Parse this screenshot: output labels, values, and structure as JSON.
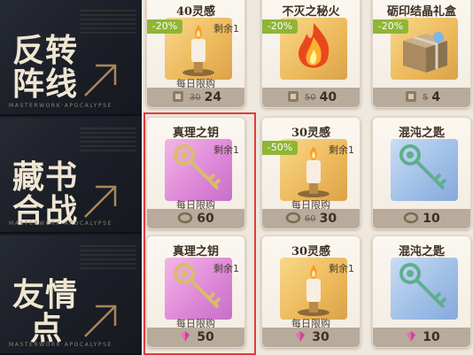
{
  "categories": [
    {
      "title_line1": "反转",
      "title_line2": "阵线",
      "motto": "MASTERWORK·APOCALYPSE"
    },
    {
      "title_line1": "藏书",
      "title_line2": "合战",
      "motto": "MASTERWORK·APOCALYPSE"
    },
    {
      "title_line1": "友情",
      "title_line2": "点",
      "motto": "MASTERWORK·APOCALYPSE"
    }
  ],
  "rows": [
    [
      {
        "name": "40灵感",
        "discount": "-20%",
        "remain": "剩余1",
        "daily": "每日限购",
        "old_price": "30",
        "price": "24",
        "icon": "candle-icon",
        "currency": "ticket-icon",
        "art": "gold"
      },
      {
        "name": "不灭之秘火",
        "discount": "-20%",
        "remain": "",
        "daily": "",
        "old_price": "50",
        "price": "40",
        "icon": "fire-icon",
        "currency": "ticket-icon",
        "art": "gold"
      },
      {
        "name": "砺印结晶礼盒",
        "discount": "-20%",
        "remain": "",
        "daily": "",
        "old_price": "5",
        "price": "4",
        "icon": "gift-box-icon",
        "currency": "ticket-icon",
        "art": "gold"
      }
    ],
    [
      {
        "name": "真理之钥",
        "discount": "",
        "remain": "剩余1",
        "daily": "每日限购",
        "old_price": "",
        "price": "60",
        "icon": "key-icon",
        "currency": "ring-icon",
        "art": "pink"
      },
      {
        "name": "30灵感",
        "discount": "-50%",
        "remain": "剩余1",
        "daily": "每日限购",
        "old_price": "60",
        "price": "30",
        "icon": "candle-icon",
        "currency": "ring-icon",
        "art": "gold"
      },
      {
        "name": "混沌之匙",
        "discount": "",
        "remain": "",
        "daily": "",
        "old_price": "",
        "price": "10",
        "icon": "key-icon",
        "currency": "ring-icon",
        "art": "blue"
      }
    ],
    [
      {
        "name": "真理之钥",
        "discount": "",
        "remain": "剩余1",
        "daily": "每日限购",
        "old_price": "",
        "price": "50",
        "icon": "key-icon",
        "currency": "gem-icon",
        "art": "pink"
      },
      {
        "name": "30灵感",
        "discount": "",
        "remain": "剩余1",
        "daily": "每日限购",
        "old_price": "",
        "price": "30",
        "icon": "candle-icon",
        "currency": "gem-icon",
        "art": "gold"
      },
      {
        "name": "混沌之匙",
        "discount": "",
        "remain": "",
        "daily": "",
        "old_price": "",
        "price": "10",
        "icon": "key-icon",
        "currency": "gem-icon",
        "art": "blue"
      }
    ]
  ],
  "colors": {
    "discount_badge": "#8fb634",
    "selection_outline": "#e03c3c"
  }
}
